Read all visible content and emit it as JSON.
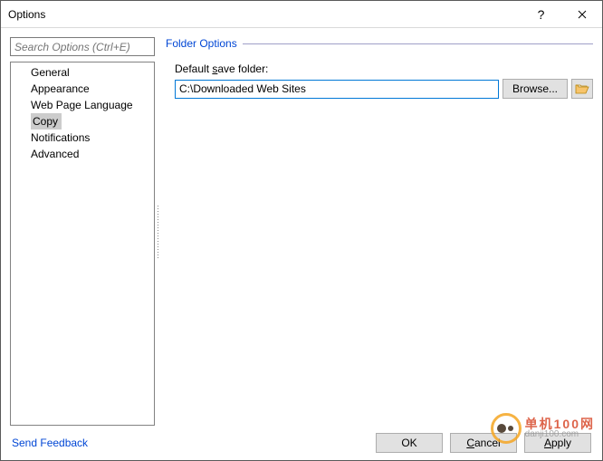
{
  "titlebar": {
    "title": "Options"
  },
  "search": {
    "placeholder": "Search Options (Ctrl+E)"
  },
  "nav": {
    "items": [
      {
        "label": "General"
      },
      {
        "label": "Appearance"
      },
      {
        "label": "Web Page Language"
      },
      {
        "label": "Copy"
      },
      {
        "label": "Notifications"
      },
      {
        "label": "Advanced"
      }
    ],
    "selected_index": 3
  },
  "panel": {
    "group_title": "Folder Options",
    "save_folder_label_pre": "Default ",
    "save_folder_label_accel": "s",
    "save_folder_label_post": "ave folder:",
    "save_folder_value": "C:\\Downloaded Web Sites",
    "browse_label": "Browse..."
  },
  "footer": {
    "feedback": "Send Feedback",
    "ok": "OK",
    "cancel_accel": "C",
    "cancel_rest": "ancel",
    "apply_accel": "A",
    "apply_rest": "pply"
  },
  "watermark": {
    "cn": "单机100网",
    "url": "danji100.com"
  }
}
